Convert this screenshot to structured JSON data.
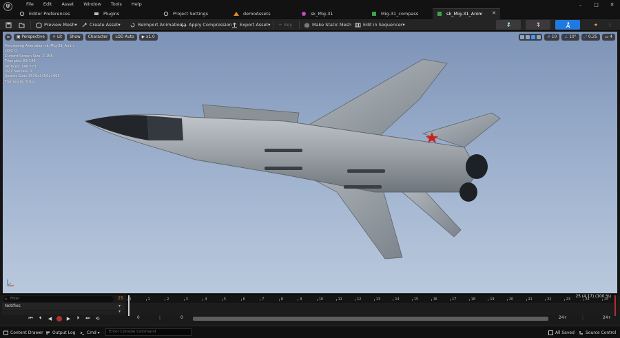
{
  "menu": [
    "File",
    "Edit",
    "Asset",
    "Window",
    "Tools",
    "Help"
  ],
  "window_controls": [
    "–",
    "□",
    "✕"
  ],
  "tabs": [
    {
      "label": "Editor Preferences"
    },
    {
      "label": "Plugins"
    },
    {
      "label": "Project Settings"
    },
    {
      "label": "demoAssets"
    },
    {
      "label": "sk_Mig-31"
    },
    {
      "label": "Mig-31_compass"
    },
    {
      "label": "sk_Mig-31_Anim",
      "active": true
    }
  ],
  "toolbar": {
    "preview_mesh": "Preview Mesh",
    "create_asset": "Create Asset",
    "reimport": "Reimport Animation",
    "apply_compression": "Apply Compression",
    "export_asset": "Export Asset",
    "key": "Key",
    "make_static_mesh": "Make Static Mesh",
    "edit_in_sequencer": "Edit in Sequencer"
  },
  "viewport": {
    "chips": [
      "Perspective",
      "Lit",
      "Show",
      "Character",
      "LOD Auto",
      "x1.0"
    ],
    "grid_size": "10",
    "rotation_snap": "10°",
    "scale_snap": "0.25",
    "camera_speed": "4",
    "stats": [
      "Previewing Animation sk_Mig-31_Anim",
      "LOD: 0",
      "Current Screen Size: 2.158",
      "Triangles: 83 146",
      "Vertices: 148 773",
      "UV Channels: 1",
      "Approx Size: 1529x1456x1495",
      "Framerate: 6 fps"
    ]
  },
  "timeline": {
    "filter_placeholder": "Filter",
    "frame": "25",
    "notifies_label": "Notifies",
    "ruler_ticks": [
      "0",
      "1",
      "2",
      "3",
      "4",
      "5",
      "6",
      "7",
      "8",
      "9",
      "10",
      "11",
      "12",
      "13",
      "14",
      "15",
      "16",
      "17",
      "18",
      "19",
      "20",
      "21",
      "22",
      "23",
      "24",
      "25"
    ],
    "readout": "25 (4.17) (100 %)",
    "range_start_a": "0",
    "range_start_b": "0",
    "range_end_a": "24+",
    "range_end_b": "24+"
  },
  "statusbar": {
    "content_drawer": "Content Drawer",
    "output_log": "Output Log",
    "cmd": "Cmd",
    "console_placeholder": "Enter Console Command",
    "all_saved": "All Saved",
    "source_control": "Source Control"
  },
  "colors": {
    "accent_blue": "#1f7ae0",
    "record_red": "#b0302e",
    "frame_orange": "#e88a2a"
  }
}
